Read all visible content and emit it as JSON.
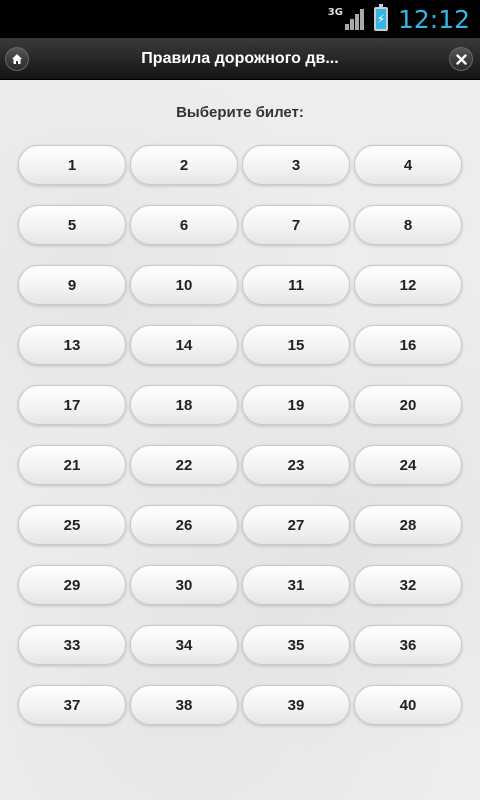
{
  "status_bar": {
    "network": "3G",
    "time": "12:12"
  },
  "header": {
    "title": "Правила дорожного дв...",
    "home_icon": "home-icon",
    "close_icon": "close-icon"
  },
  "main": {
    "prompt": "Выберите билет:",
    "tickets": [
      "1",
      "2",
      "3",
      "4",
      "5",
      "6",
      "7",
      "8",
      "9",
      "10",
      "11",
      "12",
      "13",
      "14",
      "15",
      "16",
      "17",
      "18",
      "19",
      "20",
      "21",
      "22",
      "23",
      "24",
      "25",
      "26",
      "27",
      "28",
      "29",
      "30",
      "31",
      "32",
      "33",
      "34",
      "35",
      "36",
      "37",
      "38",
      "39",
      "40"
    ]
  },
  "colors": {
    "header_bg": "#1e1e1e",
    "clock": "#33b5e5",
    "content_bg": "#ededed"
  }
}
